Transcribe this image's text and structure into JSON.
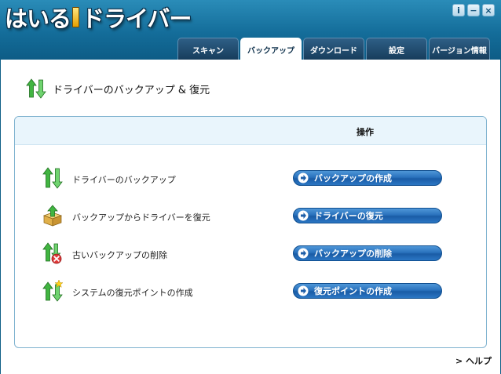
{
  "header": {
    "logo_left": "はいる",
    "logo_right": "ドライバー",
    "window_buttons": {
      "info": "i",
      "minimize": "−",
      "close": "×"
    }
  },
  "tabs": [
    {
      "label": "スキャン",
      "active": false
    },
    {
      "label": "バックアップ",
      "active": true
    },
    {
      "label": "ダウンロード",
      "active": false
    },
    {
      "label": "設定",
      "active": false
    },
    {
      "label": "バージョン情報",
      "active": false
    }
  ],
  "main": {
    "title": "ドライバーのバックアップ & 復元",
    "column_header": "操作",
    "rows": [
      {
        "label": "ドライバーのバックアップ",
        "icon": "backup-arrows-icon",
        "action": "バックアップの作成"
      },
      {
        "label": "バックアップからドライバーを復元",
        "icon": "restore-box-icon",
        "action": "ドライバーの復元"
      },
      {
        "label": "古いバックアップの削除",
        "icon": "delete-backup-icon",
        "action": "バックアップの削除"
      },
      {
        "label": "システムの復元ポイントの作成",
        "icon": "restore-point-icon",
        "action": "復元ポイントの作成"
      }
    ],
    "help": "> ヘルプ"
  },
  "colors": {
    "header_blue": "#146d9a",
    "button_blue": "#2a72bd",
    "arrow_green": "#3ea83e",
    "tab_dark": "#173d5c"
  }
}
